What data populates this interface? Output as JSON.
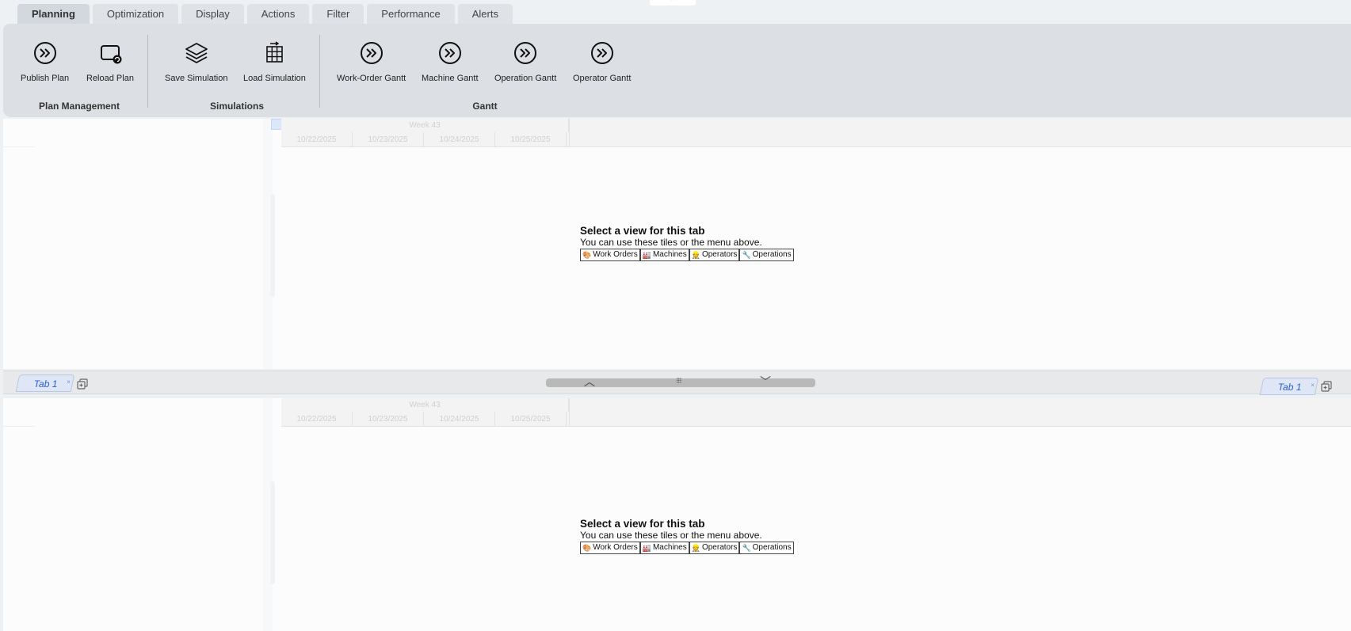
{
  "ribbon_tabs": [
    "Planning",
    "Optimization",
    "Display",
    "Actions",
    "Filter",
    "Performance",
    "Alerts"
  ],
  "collapse_glyph": "⌃",
  "ribbon": {
    "buttons": {
      "publish": "Publish Plan",
      "reload": "Reload Plan",
      "save_sim": "Save Simulation",
      "load_sim": "Load Simulation",
      "wo_gantt": "Work-Order Gantt",
      "machine_gantt": "Machine Gantt",
      "operation_gantt": "Operation Gantt",
      "operator_gantt": "Operator Gantt"
    },
    "groups": {
      "plan_mgmt": "Plan Management",
      "simulations": "Simulations",
      "gantt": "Gantt"
    }
  },
  "timeline": {
    "week": "Week 43",
    "days": [
      "10/22/2025",
      "10/23/2025",
      "10/24/2025",
      "10/25/2025"
    ]
  },
  "empty_view": {
    "title": "Select a view for this tab",
    "subtitle": "You can use these tiles or the menu above.",
    "tiles": [
      {
        "icon": "🎨",
        "label": "Work Orders"
      },
      {
        "icon": "🏭",
        "label": "Machines"
      },
      {
        "icon": "👷",
        "label": "Operators"
      },
      {
        "icon": "🔧",
        "label": "Operations"
      }
    ]
  },
  "tabbar": {
    "left_tab": "Tab 1",
    "right_tab": "Tab 1",
    "close_glyph": "×",
    "splitter_up": "︿",
    "splitter_grip": "⁝⁝⁝",
    "splitter_down": "﹀"
  }
}
